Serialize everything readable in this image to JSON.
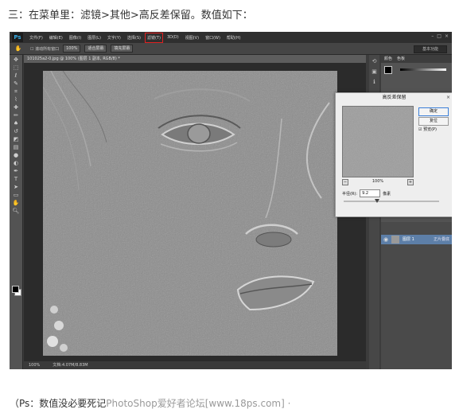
{
  "caption_top": "三：在菜单里：滤镜>其他>高反差保留。数值如下：",
  "caption_bottom": {
    "text": "（Ps：数值没必要死记",
    "watermark": "PhotoShop爱好者论坛[www.18ps.com] ·"
  },
  "ps": {
    "logo": "Ps",
    "menu": [
      "文件(F)",
      "编辑(E)",
      "图像(I)",
      "图层(L)",
      "文字(Y)",
      "选择(S)",
      "滤镜(T)",
      "3D(D)",
      "视图(V)",
      "窗口(W)",
      "帮助(H)"
    ],
    "active_menu": "滤镜(T)",
    "options": {
      "scroll_all": "滚动所有窗口",
      "zoom_100": "100%",
      "fit_screen": "适合屏幕",
      "fill_screen": "填充屏幕",
      "workspace": "基本功能"
    },
    "doc_tab": "101025a2-0.jpg @ 100% (图层 1 副本, RGB/8) *",
    "status": {
      "zoom": "100%",
      "doc": "文档:4.07M/8.83M"
    },
    "right_panel": {
      "tabs": [
        "颜色",
        "色板"
      ],
      "layer_name": "图层 1",
      "layer_mode": "正片叠底"
    },
    "dialog": {
      "title": "高反差保留",
      "ok": "确定",
      "reset": "复位",
      "preview_label": "预览(P)",
      "zoom": "100%",
      "radius_label": "半径(R):",
      "radius_value": "9.2",
      "unit": "像素",
      "slider_fraction": 0.35
    }
  }
}
